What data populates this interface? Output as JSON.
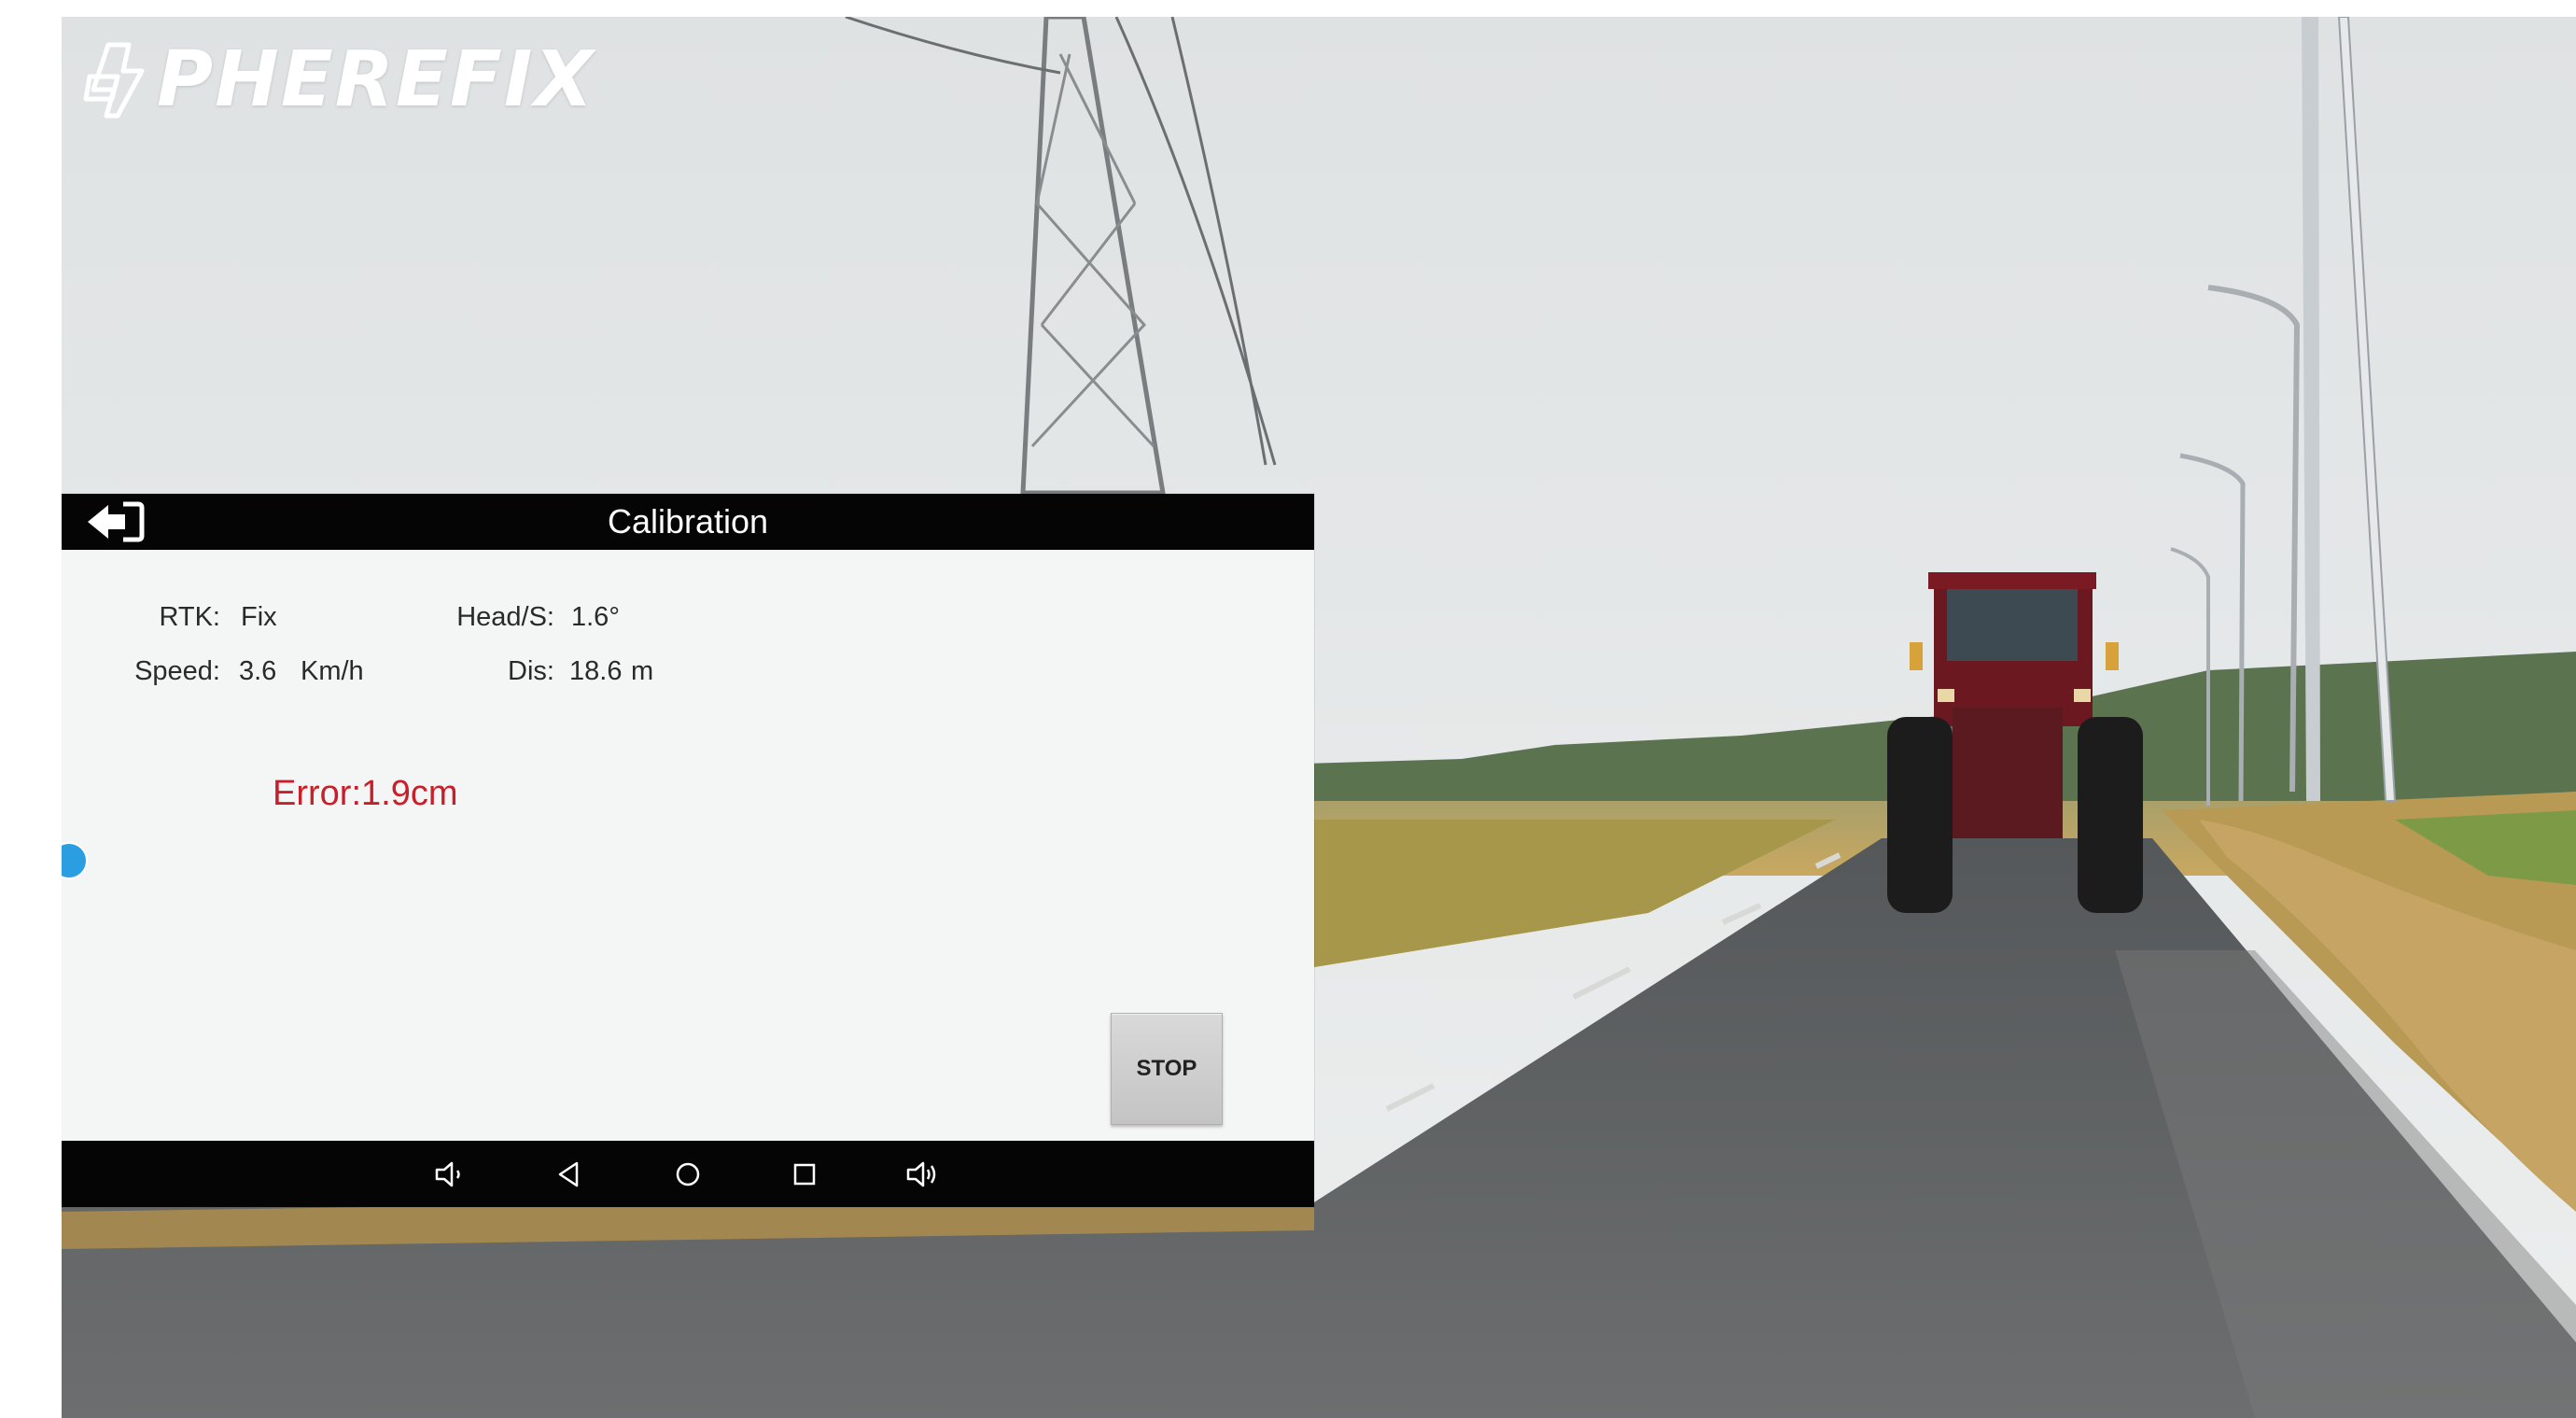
{
  "brand": {
    "logo_text": "PHEREFIX"
  },
  "app": {
    "title": "Calibration",
    "info": {
      "rtk_label": "RTK:",
      "rtk_value": "Fix",
      "speed_label": "Speed:",
      "speed_value": "3.6",
      "speed_unit": "Km/h",
      "head_label": "Head/S:",
      "head_value": "1.6°",
      "dis_label": "Dis:",
      "dis_value": "18.6",
      "dis_unit": "m"
    },
    "error_text": "Error:1.9cm",
    "stop_label": "STOP"
  },
  "icons": {
    "back": "back-arrow-icon",
    "volume_down": "volume-down-icon",
    "back_nav": "triangle-back-icon",
    "home": "circle-home-icon",
    "recents": "square-recents-icon",
    "volume_up": "volume-up-icon",
    "float": "floating-assist-icon"
  },
  "colors": {
    "header_bg": "#050505",
    "panel_bg": "#f4f5f5",
    "error": "#c8202a",
    "float_button": "#2a9ee0"
  }
}
